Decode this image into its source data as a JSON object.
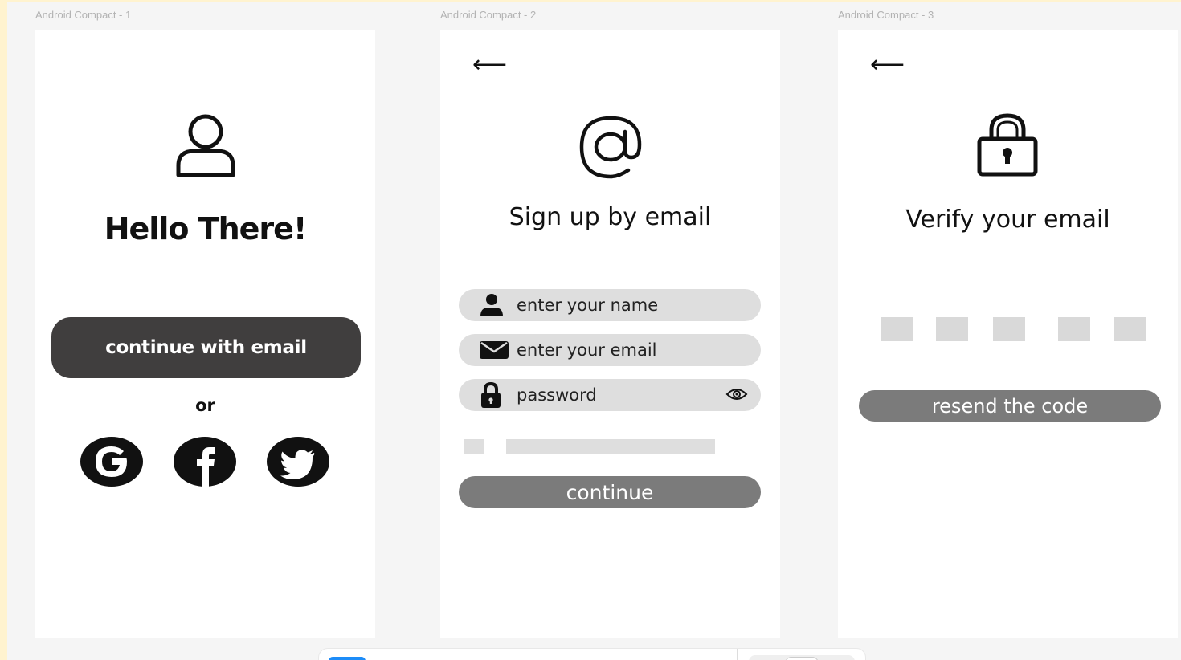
{
  "frames": [
    {
      "label": "Android Compact - 1"
    },
    {
      "label": "Android Compact - 2"
    },
    {
      "label": "Android Compact - 3"
    }
  ],
  "screen1": {
    "title": "Hello There!",
    "continue_label": "continue with email",
    "or_label": "or",
    "icons": {
      "user": "user-icon",
      "google": "google-icon",
      "facebook": "facebook-icon",
      "twitter": "twitter-icon"
    }
  },
  "screen2": {
    "back_glyph": "⟵",
    "title": "Sign up by email",
    "name_placeholder": "enter your name",
    "email_placeholder": "enter your email",
    "password_placeholder": "password",
    "continue_label": "continue",
    "icons": {
      "at": "at-sign-icon",
      "person": "person-icon",
      "mail": "mail-icon",
      "lock": "lock-icon",
      "eye": "eye-icon"
    }
  },
  "screen3": {
    "back_glyph": "⟵",
    "title": "Verify your email",
    "resend_label": "resend the code",
    "code_boxes": 5,
    "icons": {
      "lock": "padlock-icon"
    }
  },
  "colors": {
    "dark_button": "#403e3e",
    "grey_button": "#7b7b7b",
    "input_bg": "#dedede",
    "code_box": "#d9d9d9",
    "accent_blue": "#1d8cf8"
  }
}
